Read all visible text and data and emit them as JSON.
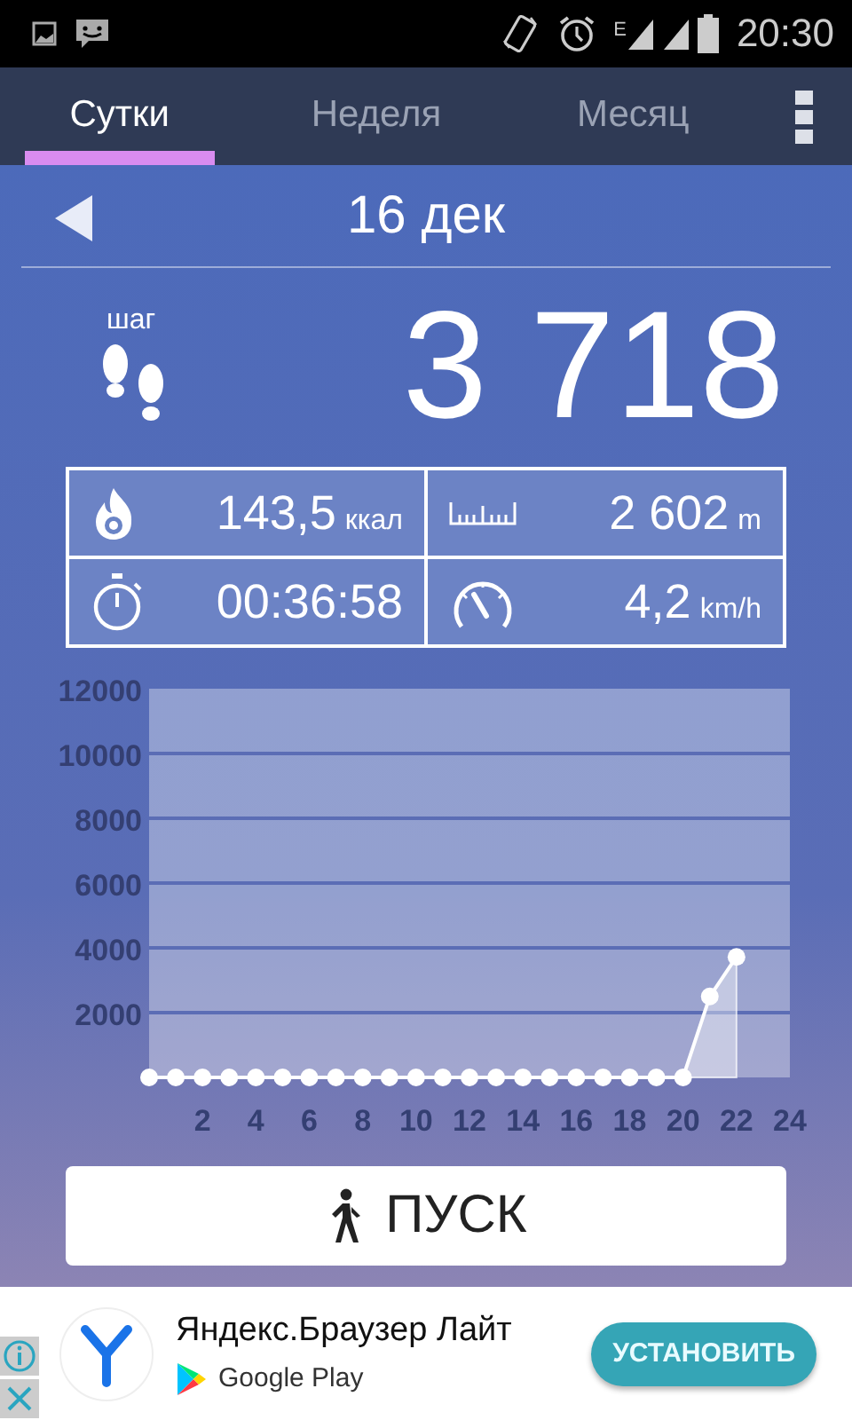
{
  "status_bar": {
    "network": "E",
    "time": "20:30"
  },
  "tabs": [
    {
      "label": "Сутки",
      "selected": true
    },
    {
      "label": "Неделя",
      "selected": false
    },
    {
      "label": "Месяц",
      "selected": false
    }
  ],
  "date": "16 дек",
  "steps": {
    "label": "шаг",
    "value": "3 718"
  },
  "stats": [
    {
      "kind": "calories",
      "value": "143,5",
      "unit": "ккал"
    },
    {
      "kind": "distance",
      "value": "2 602",
      "unit": "m"
    },
    {
      "kind": "time",
      "value": "00:36:58"
    },
    {
      "kind": "speed",
      "value": "4,2",
      "unit": "km/h"
    }
  ],
  "chart_data": {
    "type": "area",
    "grid": true,
    "marker": true,
    "x": [
      0,
      1,
      2,
      3,
      4,
      5,
      6,
      7,
      8,
      9,
      10,
      11,
      12,
      13,
      14,
      15,
      16,
      17,
      18,
      19,
      20,
      21,
      22
    ],
    "values": [
      0,
      0,
      0,
      0,
      0,
      0,
      0,
      0,
      0,
      0,
      0,
      0,
      0,
      0,
      0,
      0,
      0,
      0,
      0,
      0,
      0,
      2500,
      3718
    ],
    "xlim": [
      0,
      24
    ],
    "ylim": [
      0,
      12000
    ],
    "xticks": [
      2,
      4,
      6,
      8,
      10,
      12,
      14,
      16,
      18,
      20,
      22,
      24
    ],
    "yticks": [
      2000,
      4000,
      6000,
      8000,
      10000,
      12000
    ]
  },
  "start_button": {
    "label": "ПУСК"
  },
  "ad": {
    "title": "Яндекс.Браузер Лайт",
    "store": "Google Play",
    "button": "УСТАНОВИТЬ"
  }
}
